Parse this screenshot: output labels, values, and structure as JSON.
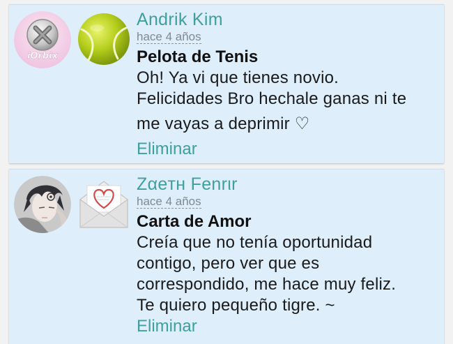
{
  "comments": [
    {
      "author": "Andrik Kim",
      "time": "hace 4 años",
      "gift_name": "Pelota de Tenis",
      "message_lines": [
        "Oh! Ya vi que tienes novio.",
        "Felicidades Bro hechale ganas ni te",
        "me vayas a deprimir ♡"
      ],
      "delete_label": "Eliminar",
      "avatar_text": "iOrbix",
      "avatar_icon": "close-x-icon",
      "gift_icon": "tennis-ball-icon"
    },
    {
      "author": "Ζαeтн Fenrιr",
      "time": "hace 4 años",
      "gift_name": "Carta de Amor",
      "message_lines": [
        "Creía que no tenía oportunidad",
        "contigo, pero ver que es",
        "correspondido, me hace muy feliz.",
        "Te quiero pequeño tigre. ~"
      ],
      "delete_label": "Eliminar",
      "avatar_icon": "anime-character-avatar",
      "gift_icon": "love-letter-envelope-icon"
    }
  ]
}
